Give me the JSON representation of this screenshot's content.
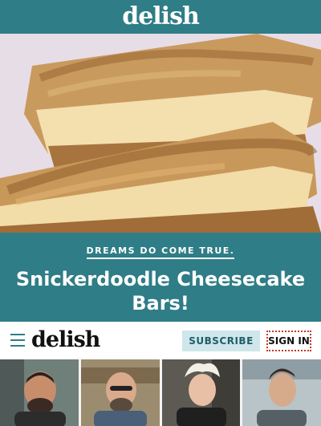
{
  "header": {
    "logo": "delish"
  },
  "hero": {
    "alt": ""
  },
  "banner": {
    "kicker": "DREAMS DO COME TRUE.",
    "headline": "Snickerdoodle Cheesecake Bars!"
  },
  "nav": {
    "logo": "delish",
    "subscribe_label": "SUBSCRIBE",
    "signin_label": "SIGN IN"
  },
  "colors": {
    "brand_teal": "#2f7d86",
    "subscribe_bg": "#cfe6ea",
    "signin_border": "#c0392b"
  },
  "icons": [
    "menu-icon"
  ]
}
